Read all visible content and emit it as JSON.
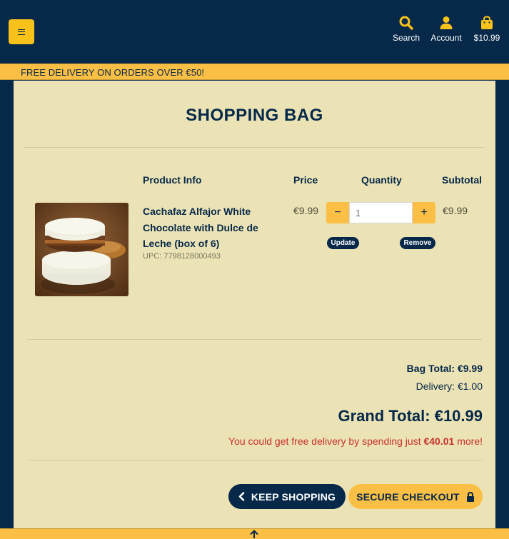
{
  "header": {
    "menu_icon": "hamburger-icon",
    "nav": [
      {
        "label": "Search",
        "icon": "search-icon"
      },
      {
        "label": "Account",
        "icon": "user-icon"
      },
      {
        "label": "$10.99",
        "icon": "shopping-bag-icon"
      }
    ]
  },
  "banner": {
    "text": "FREE DELIVERY ON ORDERS OVER €50!"
  },
  "page": {
    "title": "SHOPPING BAG"
  },
  "table": {
    "headers": {
      "product": "Product Info",
      "price": "Price",
      "quantity": "Quantity",
      "subtotal": "Subtotal"
    }
  },
  "item": {
    "name": "Cachafaz Alfajor White Chocolate with Dulce de Leche (box of 6)",
    "upc": "UPC: 7798128000493",
    "price": "€9.99",
    "quantity": "1",
    "subtotal": "€9.99",
    "minus_label": "−",
    "plus_label": "+",
    "update_label": "Update",
    "remove_label": "Remove"
  },
  "totals": {
    "bag_total": "Bag Total: €9.99",
    "delivery": "Delivery: €1.00",
    "grand_total": "Grand Total: €10.99",
    "promo_prefix": "You could get free delivery by spending just ",
    "promo_amount": "€40.01",
    "promo_suffix": " more!"
  },
  "actions": {
    "keep_shopping": "KEEP SHOPPING",
    "secure_checkout": "SECURE CHECKOUT"
  },
  "colors": {
    "navy": "#062849",
    "gold": "#fbbf45",
    "cream": "#ebe3b5",
    "promo_red": "#c8302b"
  }
}
